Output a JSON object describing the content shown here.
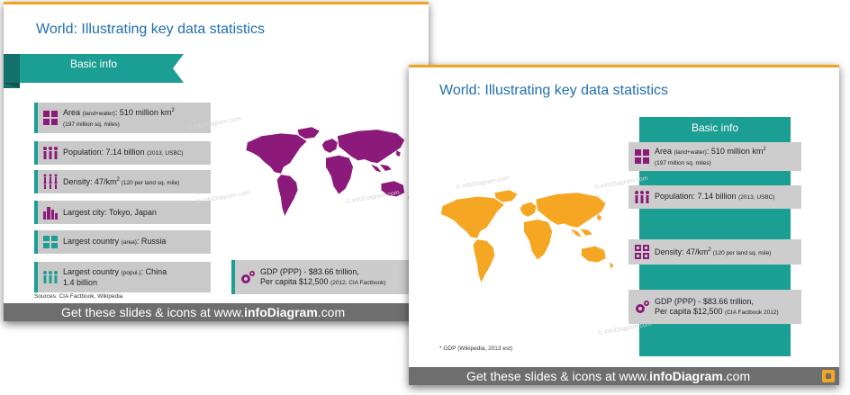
{
  "slide1": {
    "title": "World: Illustrating key data statistics",
    "banner": "Basic info",
    "rows": [
      {
        "main": "Area ",
        "small": "(land+water)",
        "main2": ": 510 million km",
        "sup": "2",
        "line2": "(197 million sq. miles)"
      },
      {
        "main": "Population: 7.14 billion ",
        "small": "(2013, USBC)"
      },
      {
        "main": "Density: 47/km",
        "sup": "2",
        "small": " (120 per land sq. mile)"
      },
      {
        "main": "Largest city: Tokyo, Japan"
      },
      {
        "main": "Largest country ",
        "small": "(area)",
        "main2": ": Russia"
      },
      {
        "main": "Largest country ",
        "small": "(popul.)",
        "main2": ": China",
        "line2": "1.4 billion"
      }
    ],
    "gdp": {
      "line1": "GDP (PPP) -  $83.66 trillion,",
      "line2": "Per capita $12,500 ",
      "small": "(2012, CIA Factbook)"
    },
    "sources": "Sources: CIA Factbook, Wikipedia",
    "footer": {
      "pre": "Get these slides & icons at www.",
      "brand": "infoDiagram",
      "post": ".com"
    },
    "watermark": "© infoDiagram.com",
    "colors": {
      "accent": "#8b1a7a",
      "teal": "#1b9e93",
      "map": "#8b1a7a"
    }
  },
  "slide2": {
    "title": "World: Illustrating key data statistics",
    "header": "Basic info",
    "rows": [
      {
        "main": "Area ",
        "small": "(land+water)",
        "main2": ": 510 million km",
        "sup": "2",
        "line2": "(197 million sq. miles)"
      },
      {
        "main": "Population: 7.14 billion ",
        "small": "(2013, USBC)"
      },
      {
        "main": "Density: 47/km",
        "sup": "2",
        "small": " (120 per land sq. mile)"
      },
      {
        "main": "GDP (PPP) -  $83.66 trillion,",
        "line2b": "Per capita $12,500 ",
        "small2": "(CIA Factbook 2012)"
      }
    ],
    "note": "* GDP (Wikipedia, 2013 est)",
    "footer": {
      "pre": "Get these slides & icons at www.",
      "brand": "infoDiagram",
      "post": ".com"
    },
    "watermark": "© infoDiagram.com",
    "colors": {
      "accent": "#8b1a7a",
      "teal": "#1b9e93",
      "map": "#f5a623"
    }
  }
}
